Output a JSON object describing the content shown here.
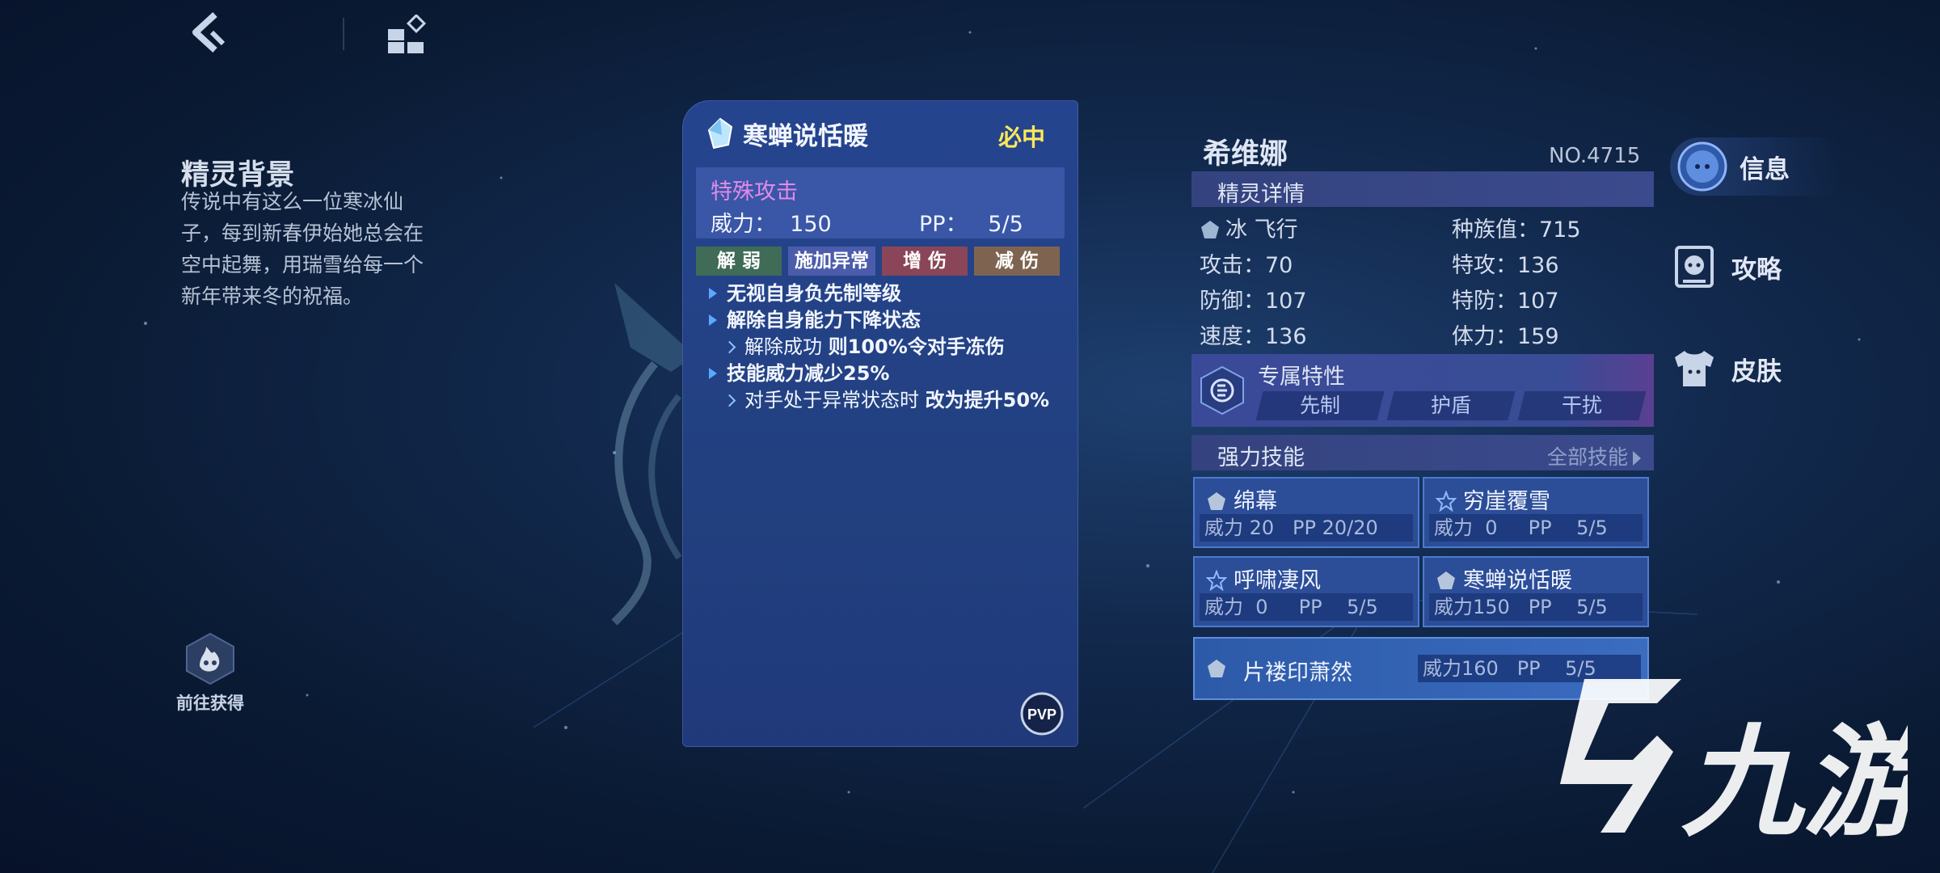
{
  "background": {
    "title": "精灵背景",
    "text": "传说中有这么一位寒冰仙子，每到新春伊始她总会在空中起舞，用瑞雪给每一个新年带来冬的祝福。",
    "obtain_label": "前往获得"
  },
  "skill_card": {
    "name": "寒蝉说恬暖",
    "tag": "必中",
    "category": "特殊攻击",
    "power_text": "威力：  150",
    "pp_text": "PP：   5/5",
    "tags": [
      "解 弱",
      "施加异常",
      "增 伤",
      "减 伤"
    ],
    "effects": {
      "e1": "无视自身负先制等级",
      "e2": "解除自身能力下降状态",
      "e3_prefix": "解除成功 ",
      "e3_strong": "则100%令对手冻伤",
      "e4": "技能威力减少25%",
      "e5_prefix": "对手处于异常状态时 ",
      "e5_strong": "改为提升50%"
    },
    "pvp_label": "PVP"
  },
  "pet": {
    "name": "希维娜",
    "number": "NO.4715",
    "details_title": "精灵详情",
    "type": "冰 飞行",
    "stats": {
      "race": "种族值：715",
      "atk": "攻击：70",
      "sp_atk": "特攻：136",
      "def": "防御：107",
      "sp_def": "特防：107",
      "speed": "速度：136",
      "hp": "体力：159"
    },
    "trait_title": "专属特性",
    "traits": [
      "先制",
      "护盾",
      "干扰"
    ],
    "moves_title": "强力技能",
    "all_moves": "全部技能",
    "moves": [
      {
        "name": "绵幕",
        "stat": "威力 20   PP 20/20"
      },
      {
        "name": "穷崖覆雪",
        "stat": "威力  0     PP    5/5"
      },
      {
        "name": "呼啸凄风",
        "stat": "威力  0     PP    5/5"
      },
      {
        "name": "寒蝉说恬暖",
        "stat": "威力150   PP    5/5"
      },
      {
        "name": "片褛印萧然",
        "stat": "威力160   PP    5/5"
      }
    ]
  },
  "nav": {
    "info": "信息",
    "guide": "攻略",
    "skin": "皮肤"
  },
  "watermark": "九游",
  "colors": {
    "accent_yellow": "#ffe85a",
    "category_pink": "#e28ae8",
    "card_blue": "#25448f"
  }
}
